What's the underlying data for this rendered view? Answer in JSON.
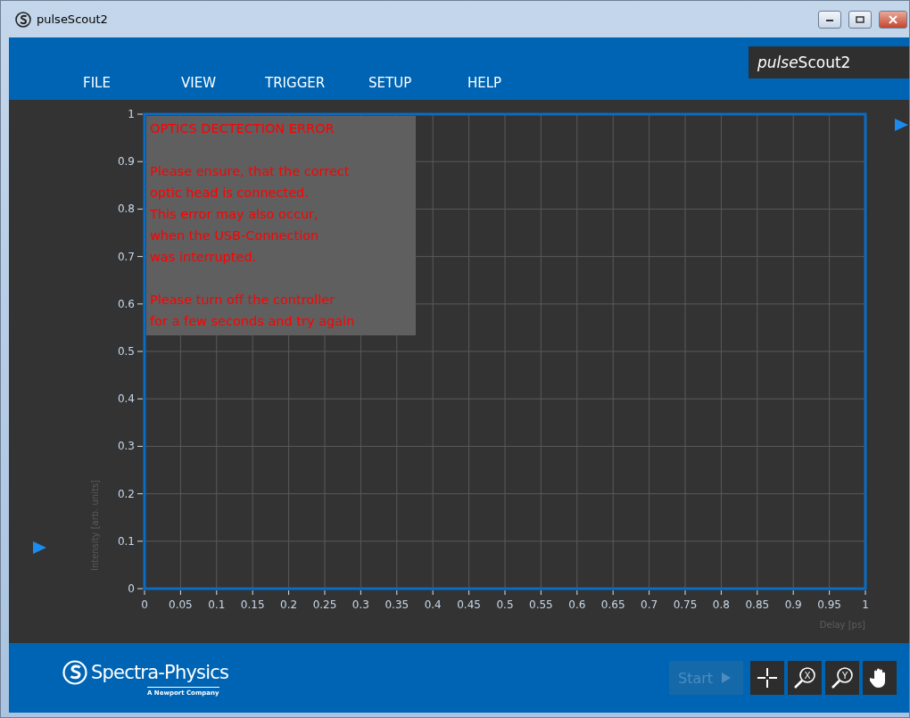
{
  "window": {
    "title": "pulseScout2"
  },
  "brand": {
    "italic": "pulse",
    "plain": "Scout2"
  },
  "menu": [
    "FILE",
    "VIEW",
    "TRIGGER",
    "SETUP",
    "HELP"
  ],
  "chart": {
    "chart_data": {
      "type": "line",
      "grid": true,
      "xlabel": "Delay [ps]",
      "ylabel": "Intensity [arb. units]",
      "xlim": [
        0,
        1
      ],
      "ylim": [
        0,
        1
      ],
      "xticks": [
        0,
        {
          "value": 0.05,
          "label": "0.05"
        },
        {
          "value": 0.1,
          "label": "0.1"
        },
        {
          "value": 0.15,
          "label": "0.15"
        },
        {
          "value": 0.2,
          "label": "0.2"
        },
        {
          "value": 0.25,
          "label": "0.25"
        },
        {
          "value": 0.3,
          "label": "0.3"
        },
        {
          "value": 0.35,
          "label": "0.35"
        },
        {
          "value": 0.4,
          "label": "0.4"
        },
        {
          "value": 0.45,
          "label": "0.45"
        },
        {
          "value": 0.5,
          "label": "0.5"
        },
        {
          "value": 0.55,
          "label": "0.55"
        },
        {
          "value": 0.6,
          "label": "0.6"
        },
        {
          "value": 0.65,
          "label": "0.65"
        },
        {
          "value": 0.7,
          "label": "0.7"
        },
        {
          "value": 0.75,
          "label": "0.75"
        },
        {
          "value": 0.8,
          "label": "0.8"
        },
        {
          "value": 0.85,
          "label": "0.85"
        },
        {
          "value": 0.9,
          "label": "0.9"
        },
        {
          "value": 0.95,
          "label": "0.95"
        },
        1
      ],
      "yticks": [
        0,
        {
          "value": 0.1,
          "label": "0.1"
        },
        {
          "value": 0.2,
          "label": "0.2"
        },
        {
          "value": 0.3,
          "label": "0.3"
        },
        {
          "value": 0.4,
          "label": "0.4"
        },
        {
          "value": 0.5,
          "label": "0.5"
        },
        {
          "value": 0.6,
          "label": "0.6"
        },
        {
          "value": 0.7,
          "label": "0.7"
        },
        {
          "value": 0.8,
          "label": "0.8"
        },
        {
          "value": 0.9,
          "label": "0.9"
        },
        1
      ]
    }
  },
  "error": {
    "title": "OPTICS DECTECTION ERROR",
    "paragraphs": [
      [
        "Please ensure, that the correct",
        "optic head is connected.",
        "This error may also occur,",
        "when the USB-Connection",
        "was interrupted."
      ],
      [
        "Please turn off the controller",
        "for a few seconds and try again"
      ]
    ]
  },
  "footer": {
    "logo": "Spectra-Physics",
    "tagline": "A Newport Company",
    "start": {
      "label": "Start",
      "disabled": true
    },
    "tools": [
      {
        "kind": "crosshair"
      },
      {
        "kind": "zoom",
        "label": "X"
      },
      {
        "kind": "zoom",
        "label": "Y"
      },
      {
        "kind": "hand"
      }
    ]
  }
}
